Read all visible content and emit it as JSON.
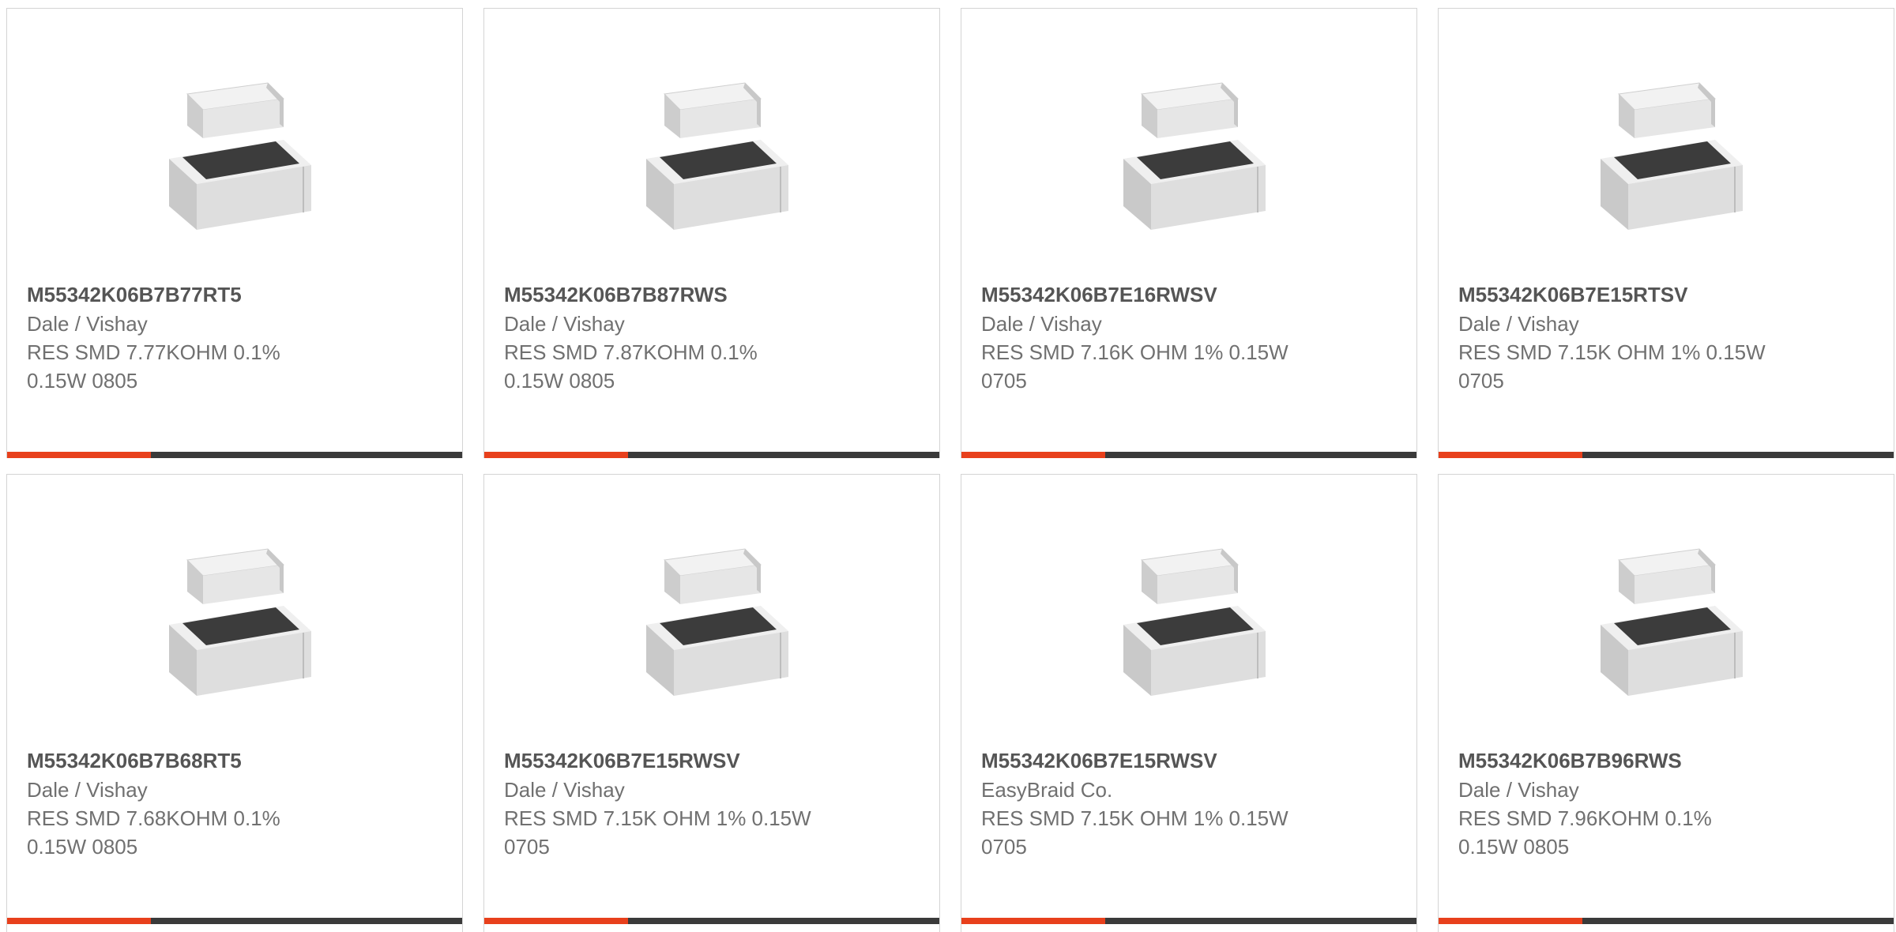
{
  "colors": {
    "accent": "#e8401c",
    "bar": "#3a3a3a",
    "border": "#d4d4d4",
    "text": "#707070",
    "title": "#555555"
  },
  "products": [
    {
      "part_number": "M55342K06B7B77RT5",
      "manufacturer": "Dale / Vishay",
      "description": "RES SMD 7.77KOHM 0.1% 0.15W 0805",
      "image_icon": "smd-resistor-image"
    },
    {
      "part_number": "M55342K06B7B87RWS",
      "manufacturer": "Dale / Vishay",
      "description": "RES SMD 7.87KOHM 0.1% 0.15W 0805",
      "image_icon": "smd-resistor-image"
    },
    {
      "part_number": "M55342K06B7E16RWSV",
      "manufacturer": "Dale / Vishay",
      "description": "RES SMD 7.16K OHM 1% 0.15W 0705",
      "image_icon": "smd-resistor-image"
    },
    {
      "part_number": "M55342K06B7E15RTSV",
      "manufacturer": "Dale / Vishay",
      "description": "RES SMD 7.15K OHM 1% 0.15W 0705",
      "image_icon": "smd-resistor-image"
    },
    {
      "part_number": "M55342K06B7B68RT5",
      "manufacturer": "Dale / Vishay",
      "description": "RES SMD 7.68KOHM 0.1% 0.15W 0805",
      "image_icon": "smd-resistor-image"
    },
    {
      "part_number": "M55342K06B7E15RWSV",
      "manufacturer": "Dale / Vishay",
      "description": "RES SMD 7.15K OHM 1% 0.15W 0705",
      "image_icon": "smd-resistor-image"
    },
    {
      "part_number": "M55342K06B7E15RWSV",
      "manufacturer": "EasyBraid Co.",
      "description": "RES SMD 7.15K OHM 1% 0.15W 0705",
      "image_icon": "smd-resistor-image"
    },
    {
      "part_number": "M55342K06B7B96RWS",
      "manufacturer": "Dale / Vishay",
      "description": "RES SMD 7.96KOHM 0.1% 0.15W 0805",
      "image_icon": "smd-resistor-image"
    }
  ]
}
